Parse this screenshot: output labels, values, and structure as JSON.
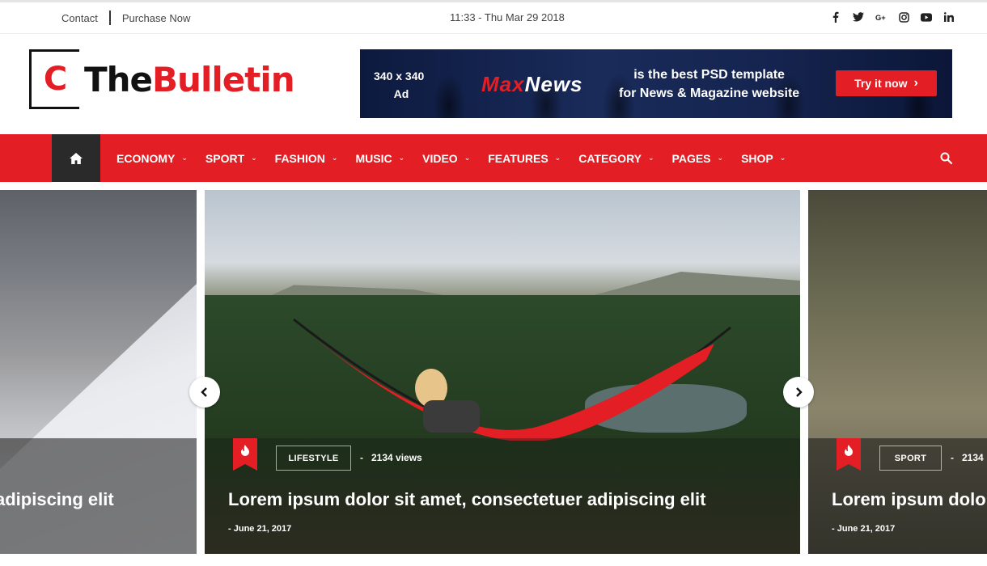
{
  "topbar": {
    "contact": "Contact",
    "purchase": "Purchase Now",
    "datetime": "11:33 - Thu Mar 29 2018",
    "social": [
      "f",
      "t",
      "G+",
      "ig",
      "yt",
      "in"
    ]
  },
  "logo": {
    "letter": "C",
    "the": "The",
    "bulletin": "Bulletin"
  },
  "ad": {
    "size_line1": "340 x 340",
    "size_line2": "Ad",
    "brand_m": "Max",
    "brand_rest": "News",
    "tag_line1": "is the best PSD template",
    "tag_line2": "for News & Magazine website",
    "cta": "Try it now"
  },
  "nav": {
    "items": [
      {
        "label": "ECONOMY"
      },
      {
        "label": "SPORT"
      },
      {
        "label": "FASHION"
      },
      {
        "label": "MUSIC"
      },
      {
        "label": "VIDEO"
      },
      {
        "label": "FEATURES"
      },
      {
        "label": "CATEGORY"
      },
      {
        "label": "PAGES"
      },
      {
        "label": "SHOP"
      }
    ]
  },
  "slides": {
    "left": {
      "title": "adipiscing elit"
    },
    "center": {
      "category": "LIFESTYLE",
      "views": "2134 views",
      "title": "Lorem ipsum dolor sit amet, consectetuer adipiscing elit",
      "date": "June 21, 2017"
    },
    "right": {
      "category": "SPORT",
      "views": "2134",
      "title": "Lorem ipsum dolo",
      "date": "June 21, 2017"
    }
  },
  "colors": {
    "accent": "#e31e24",
    "dark": "#2a2a2a"
  }
}
